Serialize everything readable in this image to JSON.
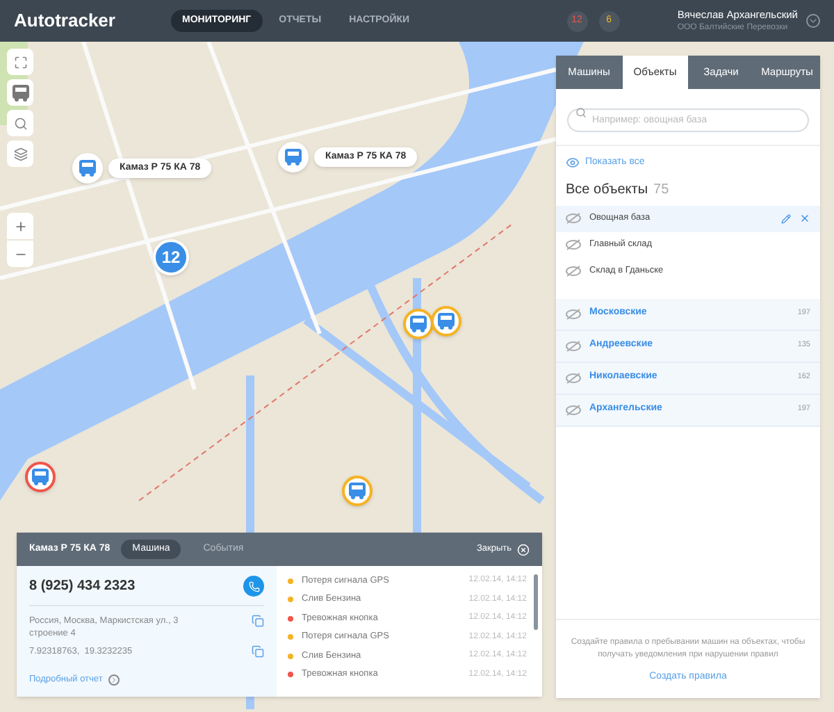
{
  "header": {
    "logo": "Autotracker",
    "nav": [
      {
        "label": "МОНИТОРИНГ",
        "selected": true
      },
      {
        "label": "ОТЧЕТЫ",
        "selected": false
      },
      {
        "label": "НАСТРОЙКИ",
        "selected": false
      }
    ],
    "badges": [
      {
        "text": "12",
        "color": "#f0564a"
      },
      {
        "text": "6",
        "color": "#f5b324"
      }
    ],
    "user": {
      "name": "Вячеслав Архангельский",
      "company": "ООО Балтийские Перевозки"
    }
  },
  "map_markers": [
    {
      "kind": "vehicle",
      "label": "Камаз Р 75 КА 78",
      "color": "#ffffff"
    },
    {
      "kind": "vehicle",
      "label": "Камаз Р 75 КА 78",
      "color": "#ffffff"
    },
    {
      "kind": "cluster",
      "label": "12"
    },
    {
      "kind": "vehicle",
      "color": "#f5b324"
    },
    {
      "kind": "vehicle",
      "color": "#f5b324"
    },
    {
      "kind": "vehicle",
      "color": "#f5b324"
    },
    {
      "kind": "vehicle",
      "color": "#f0564a"
    }
  ],
  "panel": {
    "tabs": [
      {
        "label": "Машины",
        "selected": false
      },
      {
        "label": "Объекты",
        "selected": true
      },
      {
        "label": "Задачи",
        "selected": false
      },
      {
        "label": "Маршруты",
        "selected": false
      }
    ],
    "search": {
      "placeholder": "Например: овощная база"
    },
    "show_all": "Показать все",
    "heading": "Все объекты",
    "count": "75",
    "objects": [
      {
        "name": "Овощная база",
        "selected": true
      },
      {
        "name": "Главный склад",
        "selected": false
      },
      {
        "name": "Склад в Гданьске",
        "selected": false
      }
    ],
    "groups": [
      {
        "name": "Московские",
        "count": "197"
      },
      {
        "name": "Андреевские",
        "count": "135"
      },
      {
        "name": "Николаевские",
        "count": "162"
      },
      {
        "name": "Архангельские",
        "count": "197"
      }
    ],
    "note": "Создайте правила о пребывании машин на объектах, чтобы получать уведомления при нарушении правил",
    "note_link": "Создать правила"
  },
  "vehicle_card": {
    "title": "Камаз Р 75 КА 78",
    "tabs": [
      {
        "label": "Машина",
        "selected": true
      },
      {
        "label": "События",
        "selected": false
      }
    ],
    "close": "Закрыть",
    "phone": "8 (925) 434 2323",
    "address": "Россия, Москва, Маркистская ул., 3 строение 4",
    "coords": "7.92318763,  19.3232235",
    "report_link": "Подробный отчет",
    "events": [
      {
        "name": "Потеря сигнала GPS",
        "time": "12.02.14, 14:12",
        "color": "#f5b324"
      },
      {
        "name": "Слив Бензина",
        "time": "12.02.14, 14:12",
        "color": "#f5b324"
      },
      {
        "name": "Тревожная кнопка",
        "time": "12.02.14, 14:12",
        "color": "#f0564a"
      },
      {
        "name": "Потеря сигнала GPS",
        "time": "12.02.14, 14:12",
        "color": "#f5b324"
      },
      {
        "name": "Слив Бензина",
        "time": "12.02.14, 14:12",
        "color": "#f5b324"
      },
      {
        "name": "Тревожная кнопка",
        "time": "12.02.14, 14:12",
        "color": "#f0564a"
      }
    ]
  }
}
